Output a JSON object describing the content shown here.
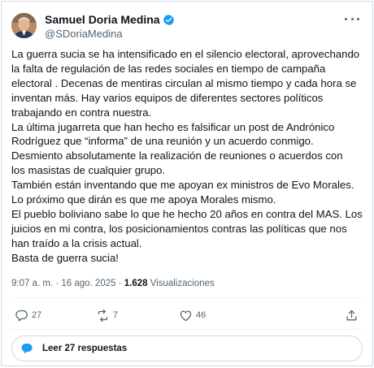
{
  "colors": {
    "accent": "#1d9bf0",
    "muted": "#536471",
    "text": "#0f1419",
    "border": "#cfd9de"
  },
  "author": {
    "display_name": "Samuel Doria Medina",
    "handle": "@SDoriaMedina",
    "verified_icon": "verified-badge-icon",
    "avatar_icon": "avatar"
  },
  "tweet": {
    "lines": [
      "La guerra sucia se ha intensificado en el silencio electoral, aprovechando",
      "la falta de regulación de las redes sociales en tiempo de campaña",
      "electoral . Decenas de mentiras circulan al mismo tiempo y cada hora se",
      "inventan más. Hay varios equipos de diferentes sectores políticos",
      "trabajando en contra nuestra.",
      "La última jugarreta que han hecho es falsificar un post de Andrónico",
      "Rodríguez que “informa” de una reunión y un acuerdo conmigo.",
      "Desmiento absolutamente la realización de reuniones o acuerdos con",
      "los masistas de cualquier grupo.",
      "También están inventando que me apoyan ex ministros de Evo Morales.",
      "Lo próximo que dirán es que me apoya Morales mismo.",
      "El pueblo boliviano sabe lo que he hecho 20 años en contra del MAS. Los",
      "juicios en mi contra, los posicionamientos contras las políticas que nos",
      "han traído a la crisis actual.",
      "Basta de guerra sucia!"
    ]
  },
  "meta": {
    "time_date": "9:07 a. m. · 16 ago. 2025 · ",
    "views_count": "1.628",
    "views_label": " Visualizaciones"
  },
  "actions": {
    "replies": {
      "icon": "reply-icon",
      "count": "27"
    },
    "reposts": {
      "icon": "repost-icon",
      "count": "7"
    },
    "likes": {
      "icon": "heart-icon",
      "count": "46"
    },
    "share": {
      "icon": "share-icon"
    }
  },
  "read_replies": {
    "icon": "reply-icon",
    "label": "Leer 27 respuestas"
  }
}
